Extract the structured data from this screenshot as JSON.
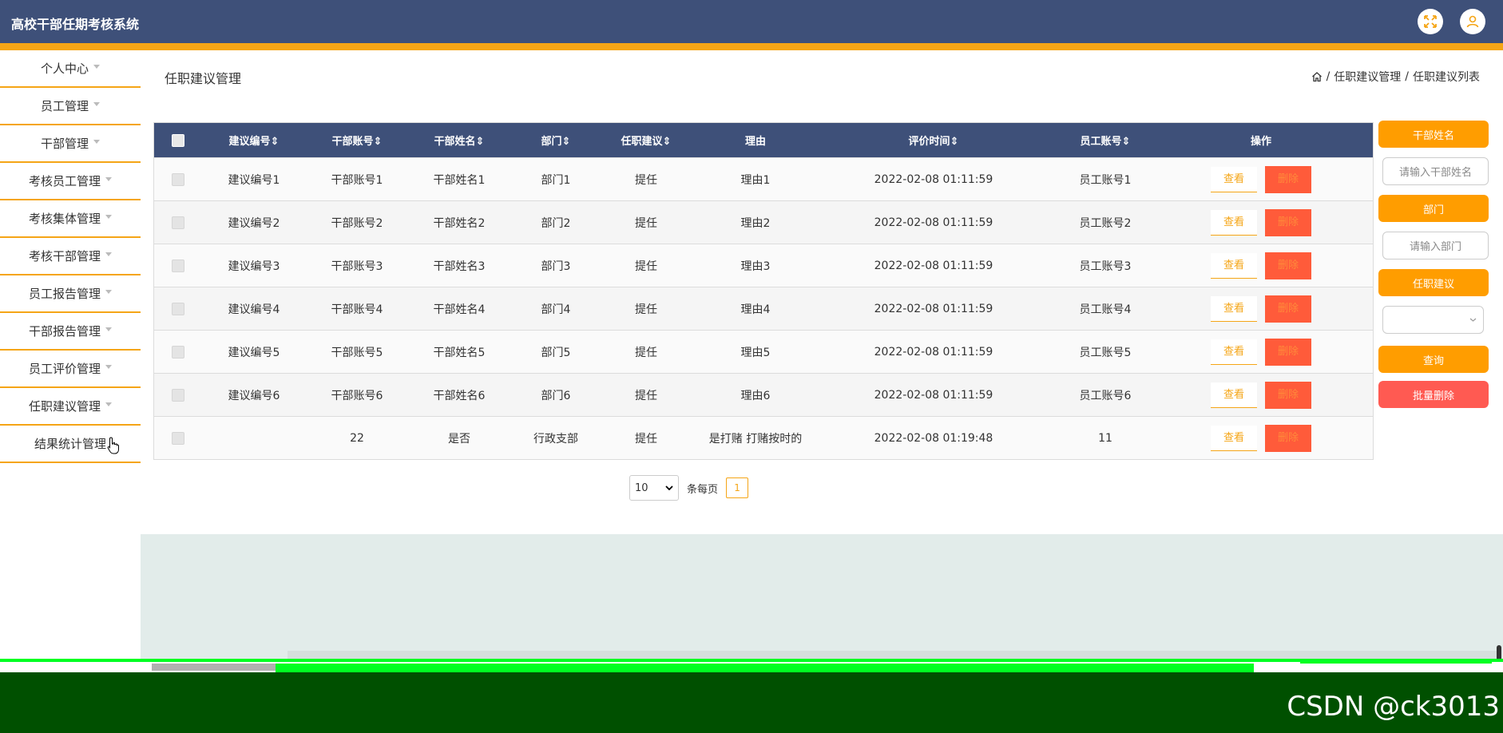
{
  "app": {
    "title": "高校干部任期考核系统"
  },
  "sidebar": {
    "items": [
      {
        "label": "个人中心"
      },
      {
        "label": "员工管理"
      },
      {
        "label": "干部管理"
      },
      {
        "label": "考核员工管理"
      },
      {
        "label": "考核集体管理"
      },
      {
        "label": "考核干部管理"
      },
      {
        "label": "员工报告管理"
      },
      {
        "label": "干部报告管理"
      },
      {
        "label": "员工评价管理"
      },
      {
        "label": "任职建议管理"
      },
      {
        "label": "结果统计管理"
      }
    ]
  },
  "page": {
    "title": "任职建议管理",
    "breadcrumb": {
      "level1": "任职建议管理",
      "level2": "任职建议列表",
      "sep": "/"
    }
  },
  "table": {
    "headers": {
      "id": "建议编号",
      "cadre_account": "干部账号",
      "cadre_name": "干部姓名",
      "dept": "部门",
      "suggestion": "任职建议",
      "reason": "理由",
      "eval_time": "评价时间",
      "emp_account": "员工账号",
      "ops": "操作"
    },
    "sort_glyph": "⇕",
    "view_label": "查看",
    "delete_label": "删除",
    "rows": [
      {
        "id": "建议编号1",
        "cadre_account": "干部账号1",
        "cadre_name": "干部姓名1",
        "dept": "部门1",
        "suggestion": "提任",
        "reason": "理由1",
        "eval_time": "2022-02-08 01:11:59",
        "emp_account": "员工账号1"
      },
      {
        "id": "建议编号2",
        "cadre_account": "干部账号2",
        "cadre_name": "干部姓名2",
        "dept": "部门2",
        "suggestion": "提任",
        "reason": "理由2",
        "eval_time": "2022-02-08 01:11:59",
        "emp_account": "员工账号2"
      },
      {
        "id": "建议编号3",
        "cadre_account": "干部账号3",
        "cadre_name": "干部姓名3",
        "dept": "部门3",
        "suggestion": "提任",
        "reason": "理由3",
        "eval_time": "2022-02-08 01:11:59",
        "emp_account": "员工账号3"
      },
      {
        "id": "建议编号4",
        "cadre_account": "干部账号4",
        "cadre_name": "干部姓名4",
        "dept": "部门4",
        "suggestion": "提任",
        "reason": "理由4",
        "eval_time": "2022-02-08 01:11:59",
        "emp_account": "员工账号4"
      },
      {
        "id": "建议编号5",
        "cadre_account": "干部账号5",
        "cadre_name": "干部姓名5",
        "dept": "部门5",
        "suggestion": "提任",
        "reason": "理由5",
        "eval_time": "2022-02-08 01:11:59",
        "emp_account": "员工账号5"
      },
      {
        "id": "建议编号6",
        "cadre_account": "干部账号6",
        "cadre_name": "干部姓名6",
        "dept": "部门6",
        "suggestion": "提任",
        "reason": "理由6",
        "eval_time": "2022-02-08 01:11:59",
        "emp_account": "员工账号6"
      },
      {
        "id": "",
        "cadre_account": "22",
        "cadre_name": "是否",
        "dept": "行政支部",
        "suggestion": "提任",
        "reason": "是打赌 打赌按时的",
        "eval_time": "2022-02-08 01:19:48",
        "emp_account": "11"
      }
    ]
  },
  "pagination": {
    "page_size": "10",
    "per_page_label": "条每页",
    "current_page": "1"
  },
  "search": {
    "cadre_name_label": "干部姓名",
    "cadre_name_placeholder": "请输入干部姓名",
    "dept_label": "部门",
    "dept_placeholder": "请输入部门",
    "suggestion_label": "任职建议",
    "suggestion_value": "",
    "query_button": "查询",
    "batch_delete_button": "批量删除"
  },
  "watermark": "CSDN @ck3013",
  "colors": {
    "header_bg": "#3e5079",
    "accent": "#f5a516",
    "delete": "#ff5b3a",
    "search_label": "#ff9d00",
    "batch_delete": "#ff5a52"
  },
  "icons": {
    "fullscreen": "expand-icon",
    "user": "user-icon",
    "home": "home-icon",
    "caret": "caret-down-icon",
    "sort": "sort-icon",
    "select_arrow": "chevron-down-icon",
    "cursor": "hand-pointer-icon"
  }
}
